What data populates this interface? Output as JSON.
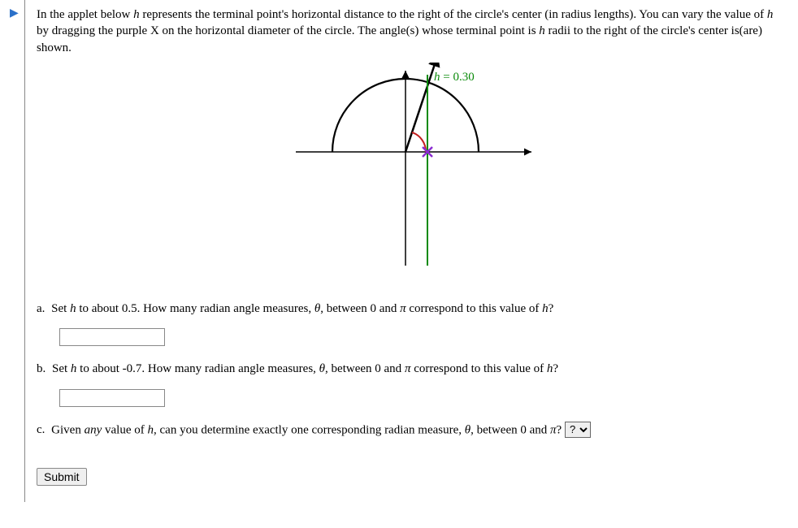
{
  "intro": {
    "part1": "In the applet below ",
    "var_h": "h",
    "part2": " represents the terminal point's horizontal distance to the right of the circle's center (in radius lengths). You can vary the value of ",
    "part3": " by dragging the purple X on the horizontal diameter of the circle. The angle(s) whose terminal point is ",
    "part4": " radii to the right of the circle's center is(are) shown."
  },
  "applet": {
    "h_label": "h",
    "h_eq": " = 0.30"
  },
  "questions": {
    "a": {
      "letter": "a.",
      "t1": " Set ",
      "t2": " to about 0.5. How many radian angle measures, ",
      "theta": "θ",
      "t3": ", between 0 and ",
      "pi": "π",
      "t4": " correspond to this value of ",
      "t5": "?"
    },
    "b": {
      "letter": "b.",
      "t1": " Set ",
      "t2": " to about -0.7. How many radian angle measures, ",
      "theta": "θ",
      "t3": ", between 0 and ",
      "pi": "π",
      "t4": " correspond to this value of ",
      "t5": "?"
    },
    "c": {
      "letter": "c.",
      "t1": " Given ",
      "any": "any",
      "t2": " value of ",
      "t3": ", can you determine exactly one corresponding radian measure, ",
      "theta": "θ",
      "t4": ", between 0 and ",
      "pi": "π",
      "t5": "? ",
      "select_default": "?"
    }
  },
  "buttons": {
    "submit": "Submit"
  }
}
